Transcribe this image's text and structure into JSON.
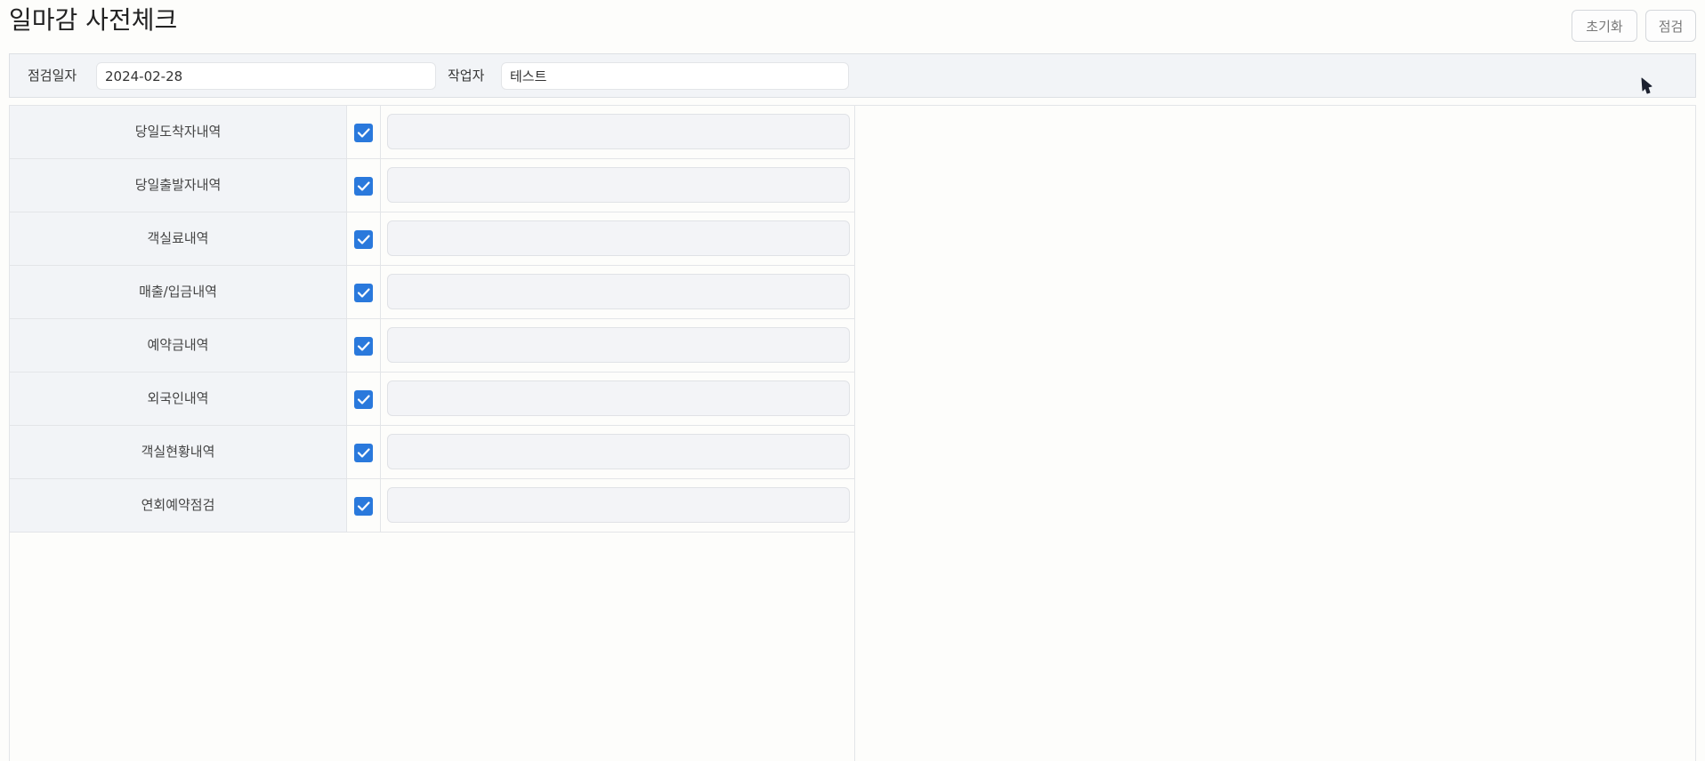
{
  "header": {
    "title": "일마감 사전체크",
    "reset_label": "초기화",
    "check_label": "점검"
  },
  "filters": {
    "date_label": "점검일자",
    "date_value": "2024-02-28",
    "worker_label": "작업자",
    "worker_value": "테스트"
  },
  "checklist": {
    "items": [
      {
        "label": "당일도착자내역",
        "checked": true,
        "note": ""
      },
      {
        "label": "당일출발자내역",
        "checked": true,
        "note": ""
      },
      {
        "label": "객실료내역",
        "checked": true,
        "note": ""
      },
      {
        "label": "매출/입금내역",
        "checked": true,
        "note": ""
      },
      {
        "label": "예약금내역",
        "checked": true,
        "note": ""
      },
      {
        "label": "외국인내역",
        "checked": true,
        "note": ""
      },
      {
        "label": "객실현황내역",
        "checked": true,
        "note": ""
      },
      {
        "label": "연회예약점검",
        "checked": true,
        "note": ""
      }
    ]
  },
  "colors": {
    "checkbox": "#2a79dc",
    "panel_bg": "#f2f4f7"
  }
}
